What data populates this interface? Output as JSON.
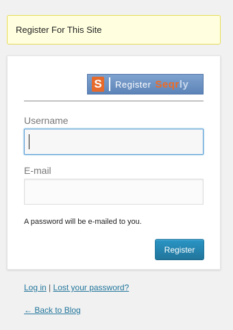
{
  "notice": {
    "message": "Register For This Site"
  },
  "logo": {
    "letter": "S",
    "text": "Register",
    "brand_main": "Seqr",
    "brand_tail": "ly"
  },
  "form": {
    "username_label": "Username",
    "username_value": "",
    "email_label": "E-mail",
    "email_value": "",
    "password_hint": "A password will be e-mailed to you.",
    "submit_label": "Register"
  },
  "nav": {
    "login_label": "Log in",
    "separator": "|",
    "lost_password_label": "Lost your password?",
    "back_label": "← Back to Blog"
  },
  "colors": {
    "notice_bg": "#ffffe0",
    "notice_border": "#e6db55",
    "button_bg": "#21759b",
    "link": "#21759b"
  }
}
